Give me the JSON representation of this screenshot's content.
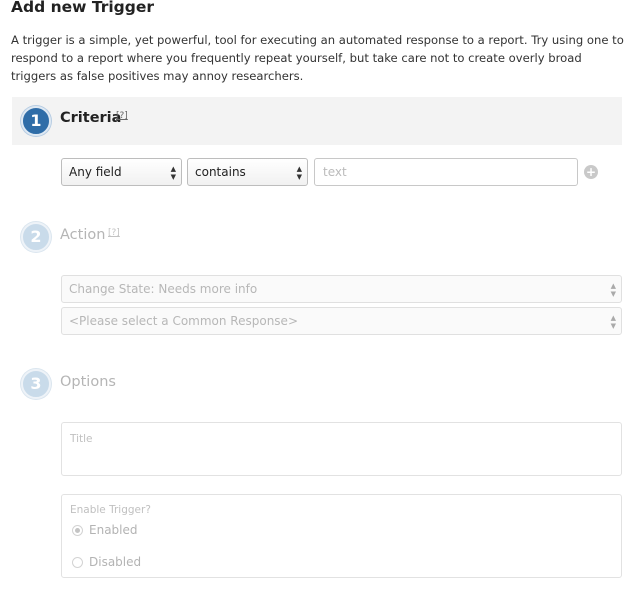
{
  "page": {
    "title": "Add new Trigger",
    "description": "A trigger is a simple, yet powerful, tool for executing an automated response to a report. Try using one to respond to a report where you frequently repeat yourself, but take care not to create overly broad triggers as false positives may annoy researchers."
  },
  "steps": [
    {
      "number": "1",
      "label": "Criteria",
      "help": "[?]",
      "state": "active"
    },
    {
      "number": "2",
      "label": "Action",
      "help": "[?]",
      "state": "inactive"
    },
    {
      "number": "3",
      "label": "Options",
      "help": "",
      "state": "inactive"
    }
  ],
  "criteria": {
    "field_select": "Any field",
    "operator_select": "contains",
    "text_placeholder": "text",
    "add_icon": "plus-circle-icon"
  },
  "action": {
    "change_state_select": "Change State: Needs more info",
    "common_response_select": "<Please select a Common Response>"
  },
  "options": {
    "title_label": "Title",
    "enable_label": "Enable Trigger?",
    "radio_enabled": "Enabled",
    "radio_disabled": "Disabled",
    "selected": "Enabled"
  },
  "colors": {
    "active_step": "#2f6da8",
    "inactive_step": "#c9dbea",
    "step_bar": "#f3f3f3"
  }
}
